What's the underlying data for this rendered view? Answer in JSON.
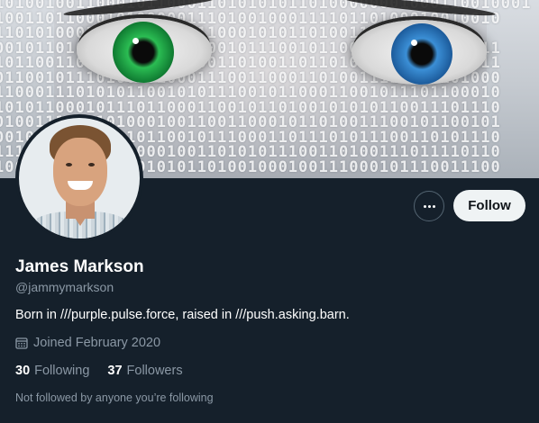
{
  "profile": {
    "name": "James Markson",
    "handle": "@jammymarkson",
    "bio": "Born in ///purple.pulse.force, raised in ///push.asking.barn.",
    "joined": "Joined February 2020",
    "following_count": "30",
    "following_label": "Following",
    "followers_count": "37",
    "followers_label": "Followers",
    "followed_context": "Not followed by anyone you’re following"
  },
  "actions": {
    "follow_label": "Follow",
    "more_icon": "more-dots-icon"
  },
  "icons": {
    "joined": "calendar-icon"
  },
  "banner": {
    "binary_rows": [
      "10100100110001011000110101010110100000001000110010001",
      "10011011000101000001110100100011110110100010010010",
      "11010100011100101101110001010110100110100110100",
      "00101101000110110010100101110010110001100010111011",
      "10110011000111010110001101001101101000101101001011",
      "01100101110100101000111001100011010011110101101000",
      "11000111010101100101011100101100011001011101100010",
      "10101100010111011000110010110100101010110011101110",
      "01001110101010001001100110001011010011100101100101",
      "00101101100011011001011100011011101011100110101110",
      "11100101101011000100110101011100110100111011110110",
      "10001000111001010101101001000100111000101110011100"
    ]
  },
  "colors": {
    "background": "#15202b",
    "secondary_text": "#8b98a5",
    "follow_button_bg": "#eff3f4"
  }
}
